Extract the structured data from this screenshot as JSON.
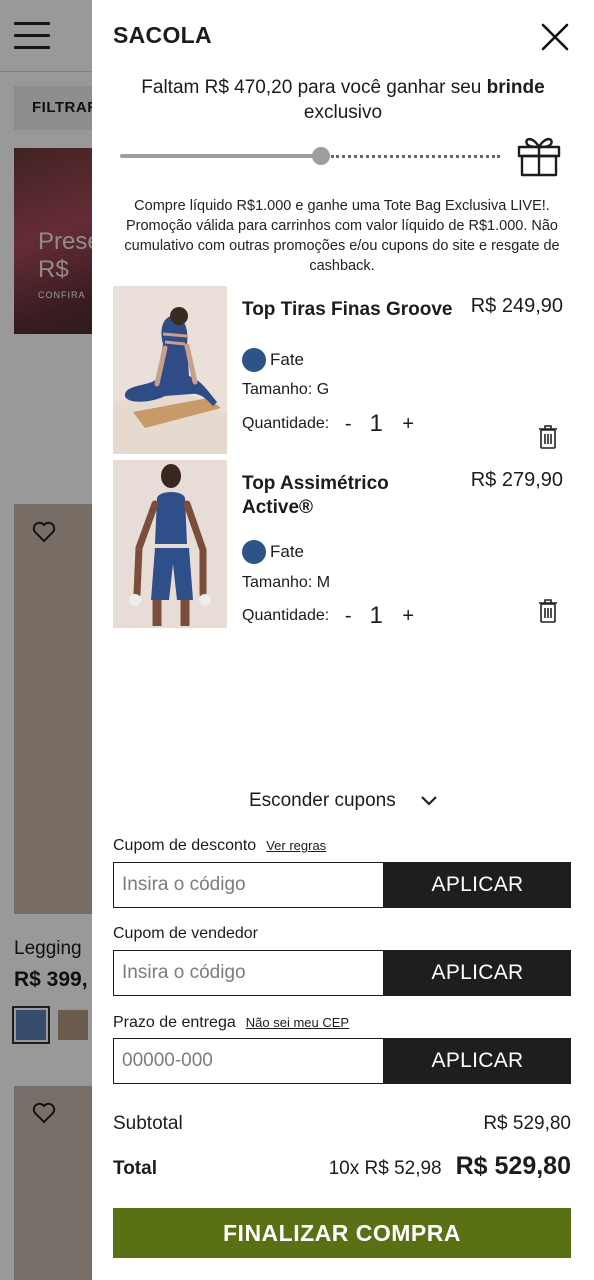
{
  "background": {
    "filter_label": "FILTRAR",
    "promo_title": "Presentes até R$",
    "promo_cta": "CONFIRA",
    "product_name": "Legging",
    "product_price": "R$ 399,"
  },
  "drawer": {
    "title": "SACOLA",
    "progress": {
      "message_prefix": "Faltam R$ 470,20 para você ganhar seu ",
      "message_bold": "brinde",
      "message_suffix": " exclusivo",
      "fraction": 0.53
    },
    "promo_note": "Compre líquido R$1.000 e ganhe uma Tote Bag Exclusiva LIVE!. Promoção válida para carrinhos com valor líquido de R$1.000. Não cumulativo com outras promoções e/ou cupons do site e resgate de cashback.",
    "items": [
      {
        "name": "Top Tiras Finas Groove",
        "price": "R$ 249,90",
        "color": "Fate",
        "color_hex": "#2e5487",
        "size": "Tamanho: G",
        "qty_label": "Quantidade:",
        "qty_minus": "-",
        "qty": "1",
        "qty_plus": "+"
      },
      {
        "name": "Top Assimétrico Active®",
        "price": "R$ 279,90",
        "color": "Fate",
        "color_hex": "#2e5487",
        "size": "Tamanho: M",
        "qty_label": "Quantidade:",
        "qty_minus": "-",
        "qty": "1",
        "qty_plus": "+"
      }
    ],
    "coupons_toggle": "Esconder cupons",
    "discount": {
      "label": "Cupom de desconto",
      "link": "Ver regras",
      "placeholder": "Insira o código",
      "button": "APLICAR"
    },
    "seller": {
      "label": "Cupom de vendedor",
      "placeholder": "Insira o código",
      "button": "APLICAR"
    },
    "shipping": {
      "label": "Prazo de entrega",
      "link": "Não sei meu CEP",
      "placeholder": "00000-000",
      "button": "APLICAR"
    },
    "subtotal_label": "Subtotal",
    "subtotal_value": "R$ 529,80",
    "total_label": "Total",
    "installments": "10x R$ 52,98",
    "total_value": "R$ 529,80",
    "checkout": "FINALIZAR COMPRA"
  },
  "colors": {
    "checkout_green": "#5a7014",
    "apply_black": "#1e1e1e",
    "progress_gray": "#9e9e9e"
  }
}
